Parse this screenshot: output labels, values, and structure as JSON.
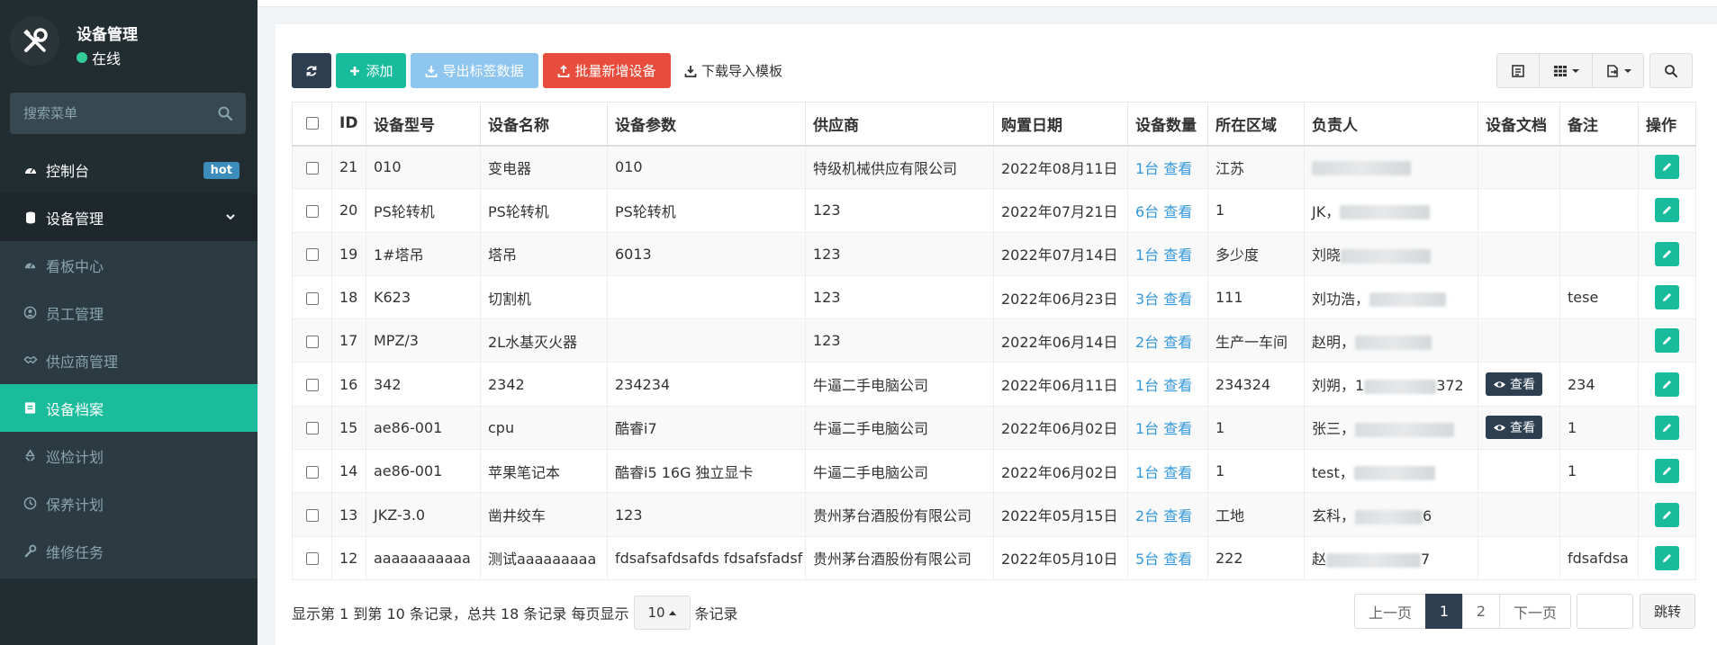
{
  "sidebar": {
    "user": {
      "name": "设备管理",
      "status": "在线"
    },
    "search": {
      "placeholder": "搜索菜单"
    },
    "items": [
      {
        "label": "控制台",
        "icon": "dashboard-icon",
        "badge": "hot"
      },
      {
        "label": "设备管理",
        "icon": "device-icon"
      },
      {
        "label": "看板中心",
        "icon": "dashboard-icon"
      },
      {
        "label": "员工管理",
        "icon": "user-icon"
      },
      {
        "label": "供应商管理",
        "icon": "handshake-icon"
      },
      {
        "label": "设备档案",
        "icon": "file-icon"
      },
      {
        "label": "巡检计划",
        "icon": "recycle-icon"
      },
      {
        "label": "保养计划",
        "icon": "clock-icon"
      },
      {
        "label": "维修任务",
        "icon": "wrench-icon"
      }
    ]
  },
  "toolbar": {
    "add": "添加",
    "export": "导出标签数据",
    "batch": "批量新增设备",
    "download": "下载导入模板"
  },
  "table": {
    "headers": [
      "ID",
      "设备型号",
      "设备名称",
      "设备参数",
      "供应商",
      "购置日期",
      "设备数量",
      "所在区域",
      "负责人",
      "设备文档",
      "备注",
      "操作"
    ],
    "view_label": "查看",
    "rows": [
      {
        "id": "21",
        "model": "010",
        "name": "变电器",
        "params": "010",
        "supplier": "特级机械供应有限公司",
        "date": "2022年08月11日",
        "qty": "1台 查看",
        "area": "江苏",
        "owner": "",
        "doc": "",
        "remark": ""
      },
      {
        "id": "20",
        "model": "PS轮转机",
        "name": "PS轮转机",
        "params": "PS轮转机",
        "supplier": "123",
        "date": "2022年07月21日",
        "qty": "6台 查看",
        "area": "1",
        "owner": "JK，",
        "doc": "",
        "remark": ""
      },
      {
        "id": "19",
        "model": "1#塔吊",
        "name": "塔吊",
        "params": "6013",
        "supplier": "123",
        "date": "2022年07月14日",
        "qty": "1台 查看",
        "area": "多少度",
        "owner": "刘晓",
        "doc": "",
        "remark": ""
      },
      {
        "id": "18",
        "model": "K623",
        "name": "切割机",
        "params": "",
        "supplier": "123",
        "date": "2022年06月23日",
        "qty": "3台 查看",
        "area": "111",
        "owner": "刘功浩，",
        "doc": "",
        "remark": "tese"
      },
      {
        "id": "17",
        "model": "MPZ/3",
        "name": "2L水基灭火器",
        "params": "",
        "supplier": "123",
        "date": "2022年06月14日",
        "qty": "2台 查看",
        "area": "生产一车间",
        "owner": "赵明，",
        "doc": "",
        "remark": ""
      },
      {
        "id": "16",
        "model": "342",
        "name": "2342",
        "params": "234234",
        "supplier": "牛逼二手电脑公司",
        "date": "2022年06月11日",
        "qty": "1台 查看",
        "area": "234324",
        "owner": "刘朔，1",
        "owner_tail": "372",
        "doc": "查看",
        "remark": "234"
      },
      {
        "id": "15",
        "model": "ae86-001",
        "name": "cpu",
        "params": "酷睿i7",
        "supplier": "牛逼二手电脑公司",
        "date": "2022年06月02日",
        "qty": "1台 查看",
        "area": "1",
        "owner": "张三，",
        "doc": "查看",
        "remark": "1"
      },
      {
        "id": "14",
        "model": "ae86-001",
        "name": "苹果笔记本",
        "params": "酷睿i5 16G 独立显卡",
        "supplier": "牛逼二手电脑公司",
        "date": "2022年06月02日",
        "qty": "1台 查看",
        "area": "1",
        "owner": "test，",
        "doc": "",
        "remark": "1"
      },
      {
        "id": "13",
        "model": "JKZ-3.0",
        "name": "凿井绞车",
        "params": "123",
        "supplier": "贵州茅台酒股份有限公司",
        "date": "2022年05月15日",
        "qty": "2台 查看",
        "area": "工地",
        "owner": "玄科，",
        "owner_tail": "6",
        "doc": "",
        "remark": ""
      },
      {
        "id": "12",
        "model": "aaaaaaaaaaa",
        "name": "测试aaaaaaaaa",
        "params": "fdsafsafdsafds fdsafsfadsf",
        "supplier": "贵州茅台酒股份有限公司",
        "date": "2022年05月10日",
        "qty": "5台 查看",
        "area": "222",
        "owner": "赵",
        "owner_tail": "7",
        "doc": "",
        "remark": "fdsafdsa"
      }
    ]
  },
  "footer": {
    "info_prefix": "显示第 1 到第 10 条记录，总共 18 条记录 每页显示",
    "page_size": "10",
    "info_suffix": "条记录",
    "prev": "上一页",
    "pages": [
      "1",
      "2"
    ],
    "next": "下一页",
    "jump": "跳转"
  },
  "colors": {
    "accent": "#18bc9c",
    "dark": "#2c3e50",
    "danger": "#e74c3c",
    "sidebar": "#222d32",
    "link": "#3498db"
  }
}
